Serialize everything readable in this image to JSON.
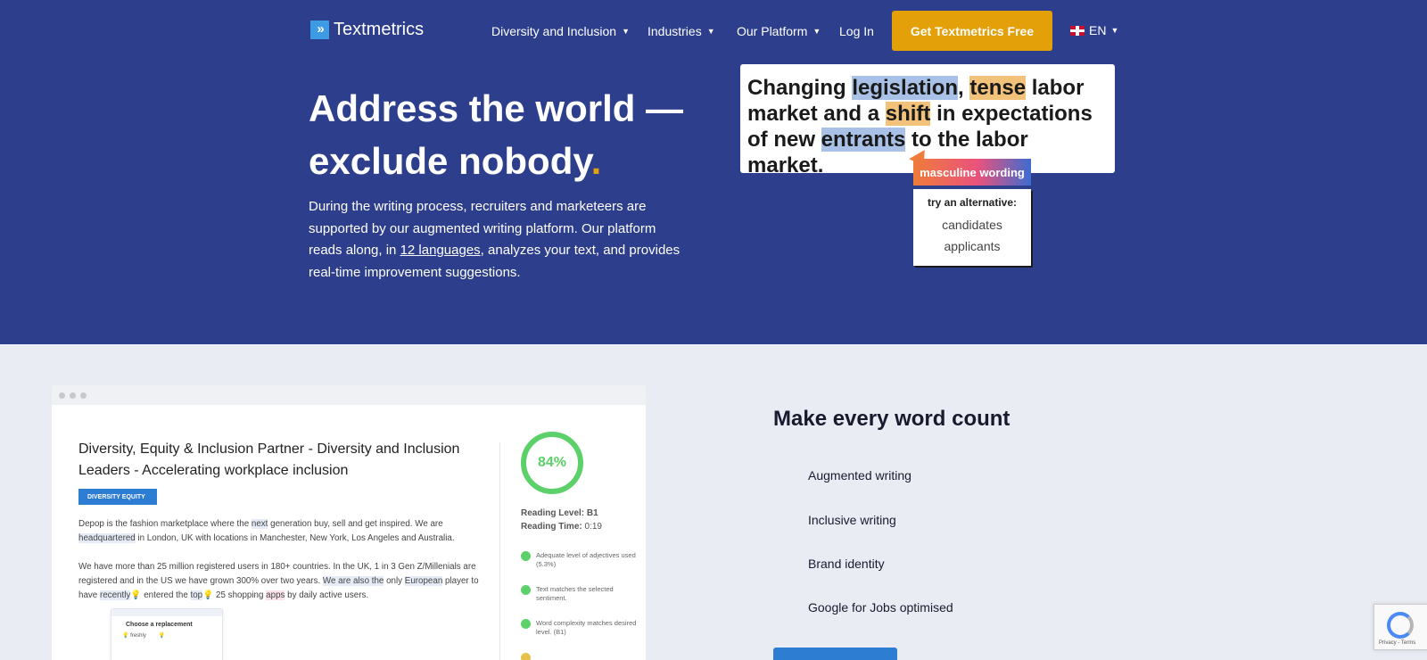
{
  "header": {
    "logo_text": "Textmetrics",
    "logo_mark": "»",
    "nav": [
      {
        "label": "Diversity and Inclusion",
        "has_dropdown": true
      },
      {
        "label": "Industries",
        "has_dropdown": true
      },
      {
        "label": "Our Platform",
        "has_dropdown": true
      },
      {
        "label": "Log In",
        "has_dropdown": false
      }
    ],
    "cta_label": "Get Textmetrics Free",
    "language": "EN",
    "colors": {
      "background": "#2d3e8c",
      "cta": "#e3a008"
    }
  },
  "hero": {
    "headline_line1": "Address the world —",
    "headline_line2": "exclude nobody",
    "headline_dot": ".",
    "intro_before": "During the writing process, recruiters and marketeers are supported by our augmented writing platform. Our platform reads along, in ",
    "intro_link": "12 languages",
    "intro_after": ", analyzes your text, and provides real-time improvement suggestions.",
    "demo": {
      "t1": "Changing ",
      "w1": "legislation",
      "t2": ", ",
      "w2": "tense",
      "t3": " labor market and a ",
      "w3": "shift",
      "t4": " in expectations of new ",
      "w4": "entrants",
      "t5": " to the labor market.",
      "tag": "masculine wording",
      "alt_title": "try an alternative:",
      "alternatives": [
        "candidates",
        "applicants"
      ]
    }
  },
  "app_demo": {
    "doc_title": "Diversity, Equity & Inclusion Partner - Diversity and Inclusion Leaders - Accelerating workplace inclusion",
    "badge": "DIVERSITY EQUITY",
    "p1": {
      "a": "Depop is the fashion marketplace where the ",
      "m1": "next",
      "b": " generation buy, sell and get inspired. We are ",
      "m2": "headquartered",
      "c": " in London, UK with locations in Manchester, New York, Los Angeles and Australia."
    },
    "p2": {
      "a": "We have more than 25 million registered users in 180+ countries. In the UK, 1 in 3 Gen Z/Millenials are registered and in the US we have grown 300% over two years. ",
      "m1": "We are also the",
      "b": " only ",
      "m2": "European",
      "c": " player to have ",
      "m3": "recently",
      "d": " entered the ",
      "m4": "top",
      "e": " 25 shopping ",
      "m5": "apps",
      "f": " by daily active users."
    },
    "score": "84%",
    "reading_level_label": "Reading Level:",
    "reading_level": "B1",
    "reading_time_label": "Reading Time:",
    "reading_time": "0:19",
    "checks": [
      "Adequate level of adjectives used (5.3%)",
      "Text matches the selected sentiment.",
      "Word complexity matches desired level. (B1)"
    ],
    "replace_title": "Choose a replacement",
    "replace_options": [
      "freshly"
    ],
    "colors": {
      "score": "#5cd16a",
      "badge": "#2d7dd2"
    }
  },
  "features": {
    "title": "Make every word count",
    "items": [
      "Augmented writing",
      "Inclusive writing",
      "Brand identity",
      "Google for Jobs optimised"
    ]
  },
  "recaptcha": {
    "text": "Privacy - Terms"
  }
}
